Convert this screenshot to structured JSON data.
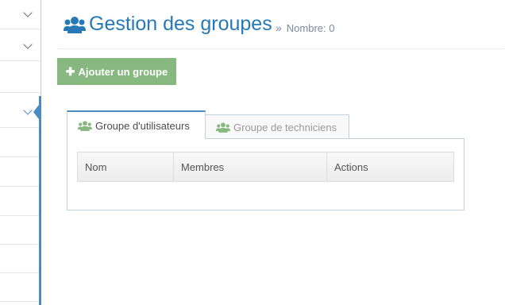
{
  "header": {
    "title": "Gestion des groupes",
    "separator": "»",
    "subtitle": "Nombre: 0"
  },
  "toolbar": {
    "add_label": "Ajouter un groupe",
    "add_icon": "plus-icon"
  },
  "tabs": [
    {
      "label": "Groupe d'utilisateurs",
      "icon": "users-icon",
      "active": true
    },
    {
      "label": "Groupe de techniciens",
      "icon": "users-icon",
      "active": false
    }
  ],
  "table": {
    "columns": [
      "Nom",
      "Membres",
      "Actions"
    ],
    "rows": []
  },
  "colors": {
    "accent": "#2679b5",
    "button": "#87b87f",
    "icon_green": "#87b87f",
    "active_border": "#4c8fbd"
  }
}
